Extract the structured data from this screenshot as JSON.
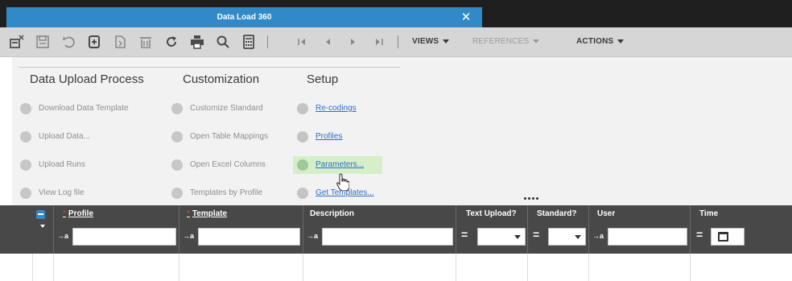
{
  "window": {
    "tab_title": "Data Load 360",
    "close_glyph": "✕"
  },
  "toolbar": {
    "icons": [
      "delete-record-icon",
      "save-icon",
      "undo-icon",
      "new-record-icon",
      "copy-record-icon",
      "trash-icon",
      "refresh-icon",
      "print-icon",
      "search-icon",
      "calculator-icon"
    ],
    "nav_icons": [
      "first-record-icon",
      "previous-record-icon",
      "next-record-icon",
      "last-record-icon"
    ],
    "views_label": "VIEWS",
    "references_label": "REFERENCES",
    "actions_label": "ACTIONS"
  },
  "panel": {
    "columns": [
      {
        "heading": "Data Upload Process",
        "items": [
          {
            "label": "Download Data Template",
            "link": false
          },
          {
            "label": "Upload Data...",
            "link": false
          },
          {
            "label": "Upload Runs",
            "link": false
          },
          {
            "label": "View Log file",
            "link": false
          }
        ]
      },
      {
        "heading": "Customization",
        "items": [
          {
            "label": "Customize Standard",
            "link": false
          },
          {
            "label": "Open Table Mappings",
            "link": false
          },
          {
            "label": "Open Excel Columns",
            "link": false
          },
          {
            "label": "Templates by Profile",
            "link": false
          }
        ]
      },
      {
        "heading": "Setup",
        "items": [
          {
            "label": "Re-codings",
            "link": true
          },
          {
            "label": "Profiles",
            "link": true
          },
          {
            "label": "Parameters...",
            "link": true,
            "hover": true
          },
          {
            "label": "Get Templates...",
            "link": true
          }
        ]
      }
    ],
    "hover_color": "#d6efc9",
    "link_color": "#2f6fc4"
  },
  "grid": {
    "columns": [
      {
        "label": "Profile",
        "required": true,
        "link": true,
        "filter_op": "→a",
        "filter_type": "text",
        "filter_value": ""
      },
      {
        "label": "Template",
        "required": true,
        "link": true,
        "filter_op": "→a",
        "filter_type": "text",
        "filter_value": ""
      },
      {
        "label": "Description",
        "required": false,
        "link": false,
        "filter_op": "→a",
        "filter_type": "text",
        "filter_value": ""
      },
      {
        "label": "Text Upload?",
        "required": false,
        "link": false,
        "filter_op": "=",
        "filter_type": "select",
        "filter_value": ""
      },
      {
        "label": "Standard?",
        "required": false,
        "link": false,
        "filter_op": "=",
        "filter_type": "select",
        "filter_value": ""
      },
      {
        "label": "User",
        "required": false,
        "link": false,
        "filter_op": "→a",
        "filter_type": "text",
        "filter_value": ""
      },
      {
        "label": "Time",
        "required": false,
        "link": false,
        "filter_op": "=",
        "filter_type": "date",
        "filter_value": ""
      }
    ],
    "required_marker": "*",
    "header_color": "#484848",
    "accent_color": "#3289c7"
  }
}
